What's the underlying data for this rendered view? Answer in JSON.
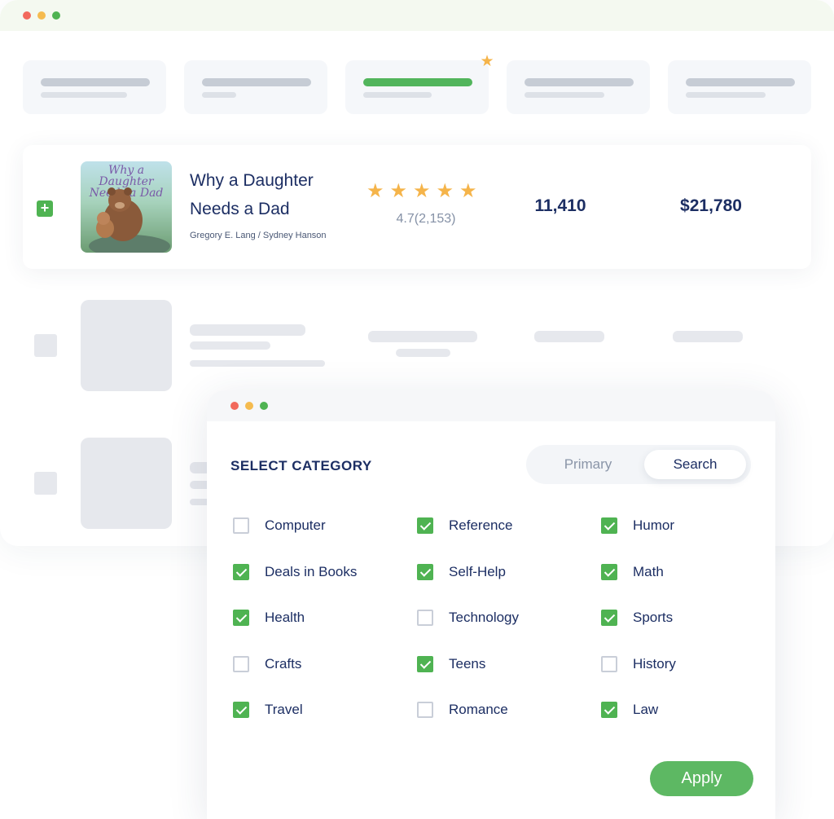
{
  "book": {
    "cover_title": "Why a Daughter Needs a Dad",
    "title_line1": "Why a Daughter",
    "title_line2": "Needs a Dad",
    "authors": "Gregory E. Lang / Sydney Hanson",
    "stars": "★★★★★",
    "rating_text": "4.7(2,153)",
    "rating_value": 4.7,
    "sales": "11,410",
    "revenue": "$21,780",
    "expand_symbol": "+"
  },
  "tabs": {
    "active_index": 2,
    "badge": "★"
  },
  "panel": {
    "heading": "SELECT CATEGORY",
    "segment": {
      "primary": "Primary",
      "search": "Search",
      "selected": "Search"
    },
    "categories": [
      {
        "label": "Computer",
        "checked": false
      },
      {
        "label": "Reference",
        "checked": true
      },
      {
        "label": "Humor",
        "checked": true
      },
      {
        "label": "Deals in Books",
        "checked": true
      },
      {
        "label": "Self-Help",
        "checked": true
      },
      {
        "label": "Math",
        "checked": true
      },
      {
        "label": "Health",
        "checked": true
      },
      {
        "label": "Technology",
        "checked": false
      },
      {
        "label": "Sports",
        "checked": true
      },
      {
        "label": "Crafts",
        "checked": false
      },
      {
        "label": "Teens",
        "checked": true
      },
      {
        "label": "History",
        "checked": false
      },
      {
        "label": "Travel",
        "checked": true
      },
      {
        "label": "Romance",
        "checked": false
      },
      {
        "label": "Law",
        "checked": true
      }
    ],
    "apply_label": "Apply"
  },
  "colors": {
    "accent_green": "#4fb352",
    "star_gold": "#f5b44a",
    "text_navy": "#1c2e63",
    "skeleton_gray": "#e6e8ed"
  }
}
